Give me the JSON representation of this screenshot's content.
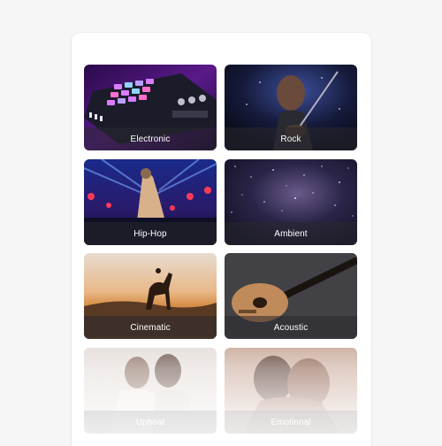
{
  "genres": [
    {
      "label": "Electronic",
      "icon": "drum-pad-controller-image"
    },
    {
      "label": "Rock",
      "icon": "guitarist-concert-image"
    },
    {
      "label": "Hip-Hop",
      "icon": "rapper-stage-lights-image"
    },
    {
      "label": "Ambient",
      "icon": "starry-night-image"
    },
    {
      "label": "Cinematic",
      "icon": "horse-rider-sunset-image"
    },
    {
      "label": "Acoustic",
      "icon": "acoustic-guitar-image"
    },
    {
      "label": "Upbeat",
      "icon": "friends-laughing-image"
    },
    {
      "label": "Emotional",
      "icon": "couple-embrace-image"
    }
  ],
  "colors": {
    "background": "#f6f6f7",
    "panel": "#ffffff",
    "caption_overlay": "rgba(40,40,46,0.55)",
    "caption_text": "#ffffff"
  }
}
